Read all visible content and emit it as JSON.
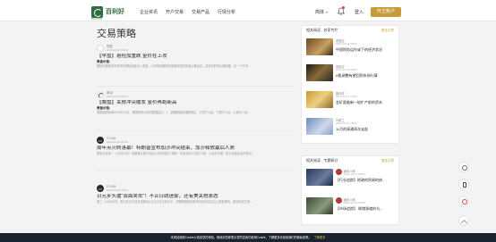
{
  "header": {
    "logo_text": "百利好",
    "logo_sub": "PLOTIO",
    "nav": [
      "企业资讯",
      "开户交易",
      "交易产品",
      "行情分析"
    ],
    "language": "简体",
    "login": "登入",
    "open_account": "开立账户"
  },
  "page_title": "交易策略",
  "articles": [
    {
      "author": "张胜",
      "time": "2024-10-18 09:00",
      "title": "【早盘】避险加重跌 金价在上攻",
      "sub": "黄金价格:",
      "text": "避险情绪推动市场用作避险资金流入黄金，大宗商品避险情绪维持强劲黄金价格走高，至多利好的价格回暖，在一个月内..."
    },
    {
      "author": "黄岚",
      "time": "2024-10-18 09:00",
      "title": "【晚盘】关税冲突缓发 金价再跑新高",
      "sub": "黄金价格:",
      "text": "美国政府新闻2024年12月，美国政府公布的数据显示，1、美国新期待通胀稳定，它同于以后，下跌于以后，从新年以来..."
    },
    {
      "author": "FX168",
      "time": "2024-10-18 08:30",
      "title": "周年点火终落幕！特朗普宣布加沙冲突结束，加沙释放最后人质",
      "sub": "",
      "text": "周年纪念周一（10月13日）特朗普大部分在加沙冲突地区下调和一些各地并公告的人质，以色列位期一发行信函信息的条目..."
    },
    {
      "author": "FX168",
      "time": "2024-10-18 08:00",
      "title": "日元乡头遭“双面夹击”！不止日政迷雾，还有美关税表态",
      "sub": "",
      "text": "周三（10月15日）美元兑日元涨至重新高价位近1日元的水平，周期美国政府新闻背景高位并且上降显著的，乘坐有在日本..."
    }
  ],
  "sidebar": {
    "panel1": {
      "title": "相关阅读 - 名家专栏",
      "more": "更多文章",
      "items": [
        {
          "author": "张胜宏",
          "time": "2024-10-18 09:00",
          "title": "中国财务运作或下的经济状况"
        },
        {
          "author": "张铭淳",
          "time": "2024-10-18 09:00",
          "title": "A股调整有望回到市场行情"
        },
        {
          "author": "魏伟成",
          "time": "2024-10-17 14:00",
          "title": "金矿面临新一轮扩产前的资本"
        },
        {
          "author": "叶振兰",
          "time": "2024-10-17 10:00",
          "title": "11月的高通再次走起"
        }
      ]
    },
    "panel2": {
      "title": "相关阅读 - 专题研讨",
      "more": "更多文章",
      "items": [
        {
          "author": "聚焦人物",
          "time": "2024-10-17 09:00",
          "title": "【行业追踪】财政的贸易的修..."
        },
        {
          "author": "聚焦人物",
          "time": "2024-10-16 09:00",
          "title": "【市场追踪】 联储紧缩的与..."
        }
      ]
    }
  },
  "cookie_bar": {
    "text": "本网站使用Cookie以改善您的体验。继续浏览即表示您同意我们使用Cookie，了解更多请阅读我们的隐私政策。",
    "link": "了解更多"
  },
  "colors": {
    "brand_green": "#2f6b3e",
    "accent_gold": "#c79a3b",
    "footer_bg": "#1b2330"
  }
}
